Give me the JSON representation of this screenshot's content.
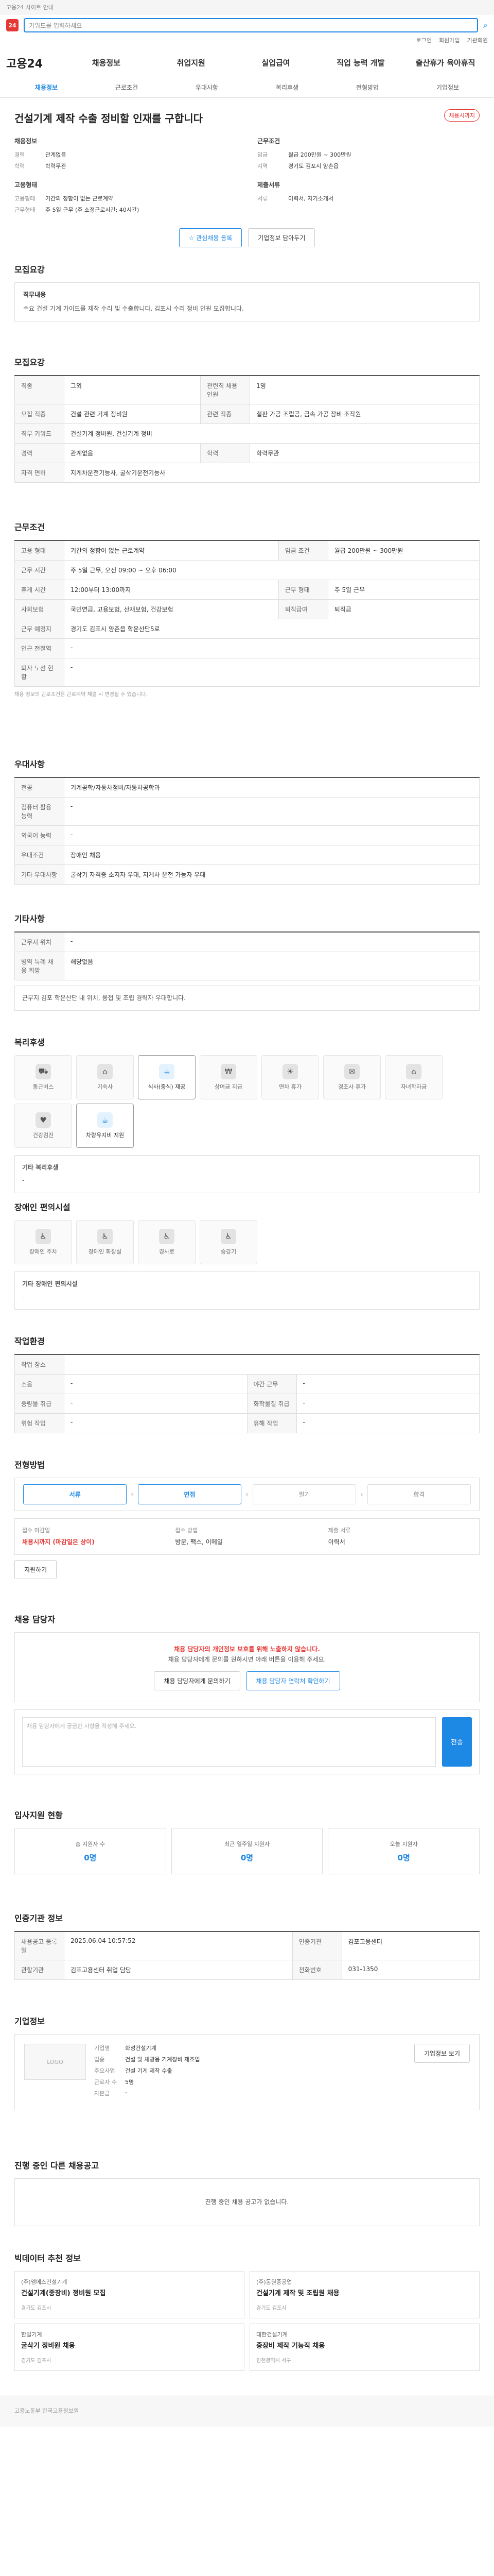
{
  "notice": "고용24 사이트 안내",
  "search": {
    "placeholder": "키워드를 입력하세요"
  },
  "util": [
    "로그인",
    "회원가입",
    "기관회원"
  ],
  "gnb": {
    "brand": "고용24",
    "items": [
      "채용정보",
      "취업지원",
      "실업급여",
      "직업 능력 개발",
      "출산휴가 육아휴직"
    ]
  },
  "lnb": [
    {
      "label": "채용정보",
      "on": true
    },
    {
      "label": "근로조건",
      "on": false
    },
    {
      "label": "우대사항",
      "on": false
    },
    {
      "label": "복리후생",
      "on": false
    },
    {
      "label": "전형방법",
      "on": false
    },
    {
      "label": "기업정보",
      "on": false
    }
  ],
  "summary": {
    "badge": "채용시까지",
    "title": "건설기계 제작 수출 정비할 인재를 구합니다",
    "left": {
      "heading": "채용정보",
      "rows": [
        {
          "k": "경력",
          "v": "관계없음"
        },
        {
          "k": "학력",
          "v": "학력무관"
        }
      ]
    },
    "left2": {
      "heading": "고용형태",
      "rows": [
        {
          "k": "고용형태",
          "v": "기간의 정함이 없는 근로계약"
        },
        {
          "k": "근무형태",
          "v": "주 5일 근무 (주 소정근로시간: 40시간)"
        }
      ]
    },
    "right": {
      "heading": "근무조건",
      "rows": [
        {
          "k": "임금",
          "v": "월급 200만원 ~ 300만원"
        },
        {
          "k": "지역",
          "v": "경기도 김포시 양촌읍"
        }
      ]
    },
    "right2": {
      "heading": "제출서류",
      "rows": [
        {
          "k": "서류",
          "v": "이력서, 자기소개서"
        }
      ]
    },
    "btn_apply": "관심채용 등록",
    "btn_share": "기업정보 담아두기"
  },
  "intro": {
    "title": "모집요강",
    "heading": "직무내용",
    "text": "수요 건설 기계 가이드를 제작 수리 및 수출합니다. 김포시 수리 정비 인원 모집합니다."
  },
  "req": {
    "title": "모집요강",
    "rows": [
      {
        "k": "직종",
        "v": "그외",
        "k2": "관련직 채용 인원",
        "v2": "1명"
      },
      {
        "k": "모집 직종",
        "v": "건설 관련 기계 정비원",
        "k2": "관련 직종",
        "v2": "철판 가공 조립공, 금속 가공 장비 조작원"
      },
      {
        "k": "직무 키워드",
        "v": "건설기계 정비원, 건설기계 정비",
        "k2": "",
        "v2": ""
      },
      {
        "k": "경력",
        "v": "관계없음",
        "k2": "학력",
        "v2": "학력무관"
      },
      {
        "k": "자격 면허",
        "v": "지게차운전기능사, 굴삭기운전기능사",
        "k2": "",
        "v2": ""
      }
    ]
  },
  "cond": {
    "title": "근무조건",
    "rows": [
      {
        "k": "고용 형태",
        "v": "기간의 정함이 없는 근로계약",
        "k2": "임금 조건",
        "v2": "월급 200만원 ~ 300만원"
      },
      {
        "k": "근무 시간",
        "v": "주 5일 근무, 오전 09:00 ~ 오후 06:00",
        "k2": "",
        "v2": ""
      },
      {
        "k": "휴게 시간",
        "v": "12:00부터 13:00까지",
        "k2": "근무 형태",
        "v2": "주 5일 근무"
      },
      {
        "k": "사회보험",
        "v": "국민연금, 고용보험, 산재보험, 건강보험",
        "k2": "퇴직급여",
        "v2": "퇴직금"
      },
      {
        "k": "근무 예정지",
        "v": "경기도 김포시 양촌읍 학운산단5로",
        "k2": "",
        "v2": ""
      },
      {
        "k": "인근 전철역",
        "v": "-",
        "k2": "",
        "v2": ""
      },
      {
        "k": "퇴사 노선 현황",
        "v": "-",
        "k2": "",
        "v2": ""
      }
    ],
    "note": "채용 정보의 근로조건은 근로계약 체결 시 변경될 수 있습니다."
  },
  "pref": {
    "title": "우대사항",
    "rows": [
      {
        "k": "전공",
        "v": "기계공학/자동차정비/자동차공학과"
      },
      {
        "k": "컴퓨터 활용 능력",
        "v": "-"
      },
      {
        "k": "외국어 능력",
        "v": "-"
      },
      {
        "k": "우대조건",
        "v": "장애인 채용"
      },
      {
        "k": "기타 우대사항",
        "v": "굴삭기 자격증 소지자 우대, 지게차 운전 가능자 우대"
      }
    ]
  },
  "etc": {
    "title": "기타사항",
    "rows": [
      {
        "k": "근무지 위치",
        "v": "-"
      },
      {
        "k": "병역 특례 채용 희망",
        "v": "해당없음"
      }
    ],
    "detail": "근무지 김포 학운산단 내 위치, 용접 및 조립 경력자 우대합니다."
  },
  "welfare": {
    "title": "복리후생",
    "items": [
      {
        "icon": "bus-icon",
        "glyph": "⛟",
        "label": "통근버스",
        "on": false
      },
      {
        "icon": "dormitory-icon",
        "glyph": "⌂",
        "label": "기숙사",
        "on": false
      },
      {
        "icon": "meal-icon",
        "glyph": "☕",
        "label": "식사(중식) 제공",
        "on": true
      },
      {
        "icon": "bonus-icon",
        "glyph": "₩",
        "label": "상여금 지급",
        "on": false
      },
      {
        "icon": "holiday-icon",
        "glyph": "☀",
        "label": "연차 휴가",
        "on": false
      },
      {
        "icon": "gift-icon",
        "glyph": "✉",
        "label": "경조사 휴가",
        "on": false
      },
      {
        "icon": "house-icon",
        "glyph": "⌂",
        "label": "자녀학자금",
        "on": false
      },
      {
        "icon": "heart-icon",
        "glyph": "♥",
        "label": "건강검진",
        "on": false
      },
      {
        "icon": "coffee-icon",
        "glyph": "☕",
        "label": "차량유지비 지원",
        "on": true
      }
    ],
    "etc_label": "기타 복리후생",
    "etc_val": "-"
  },
  "disab": {
    "title": "장애인 편의시설",
    "items": [
      "장애인 주차",
      "장애인 화장실",
      "경사로",
      "승강기"
    ],
    "etc_label": "기타 장애인 편의시설",
    "etc_val": "-"
  },
  "worksite": {
    "title": "작업환경",
    "rows": [
      {
        "k": "작업 장소",
        "v": "-",
        "k2": "",
        "v2": ""
      },
      {
        "k": "소음",
        "v": "-",
        "k2": "야간 근무",
        "v2": "-"
      },
      {
        "k": "중량물 취급",
        "v": "-",
        "k2": "화학물질 취급",
        "v2": "-"
      },
      {
        "k": "위험 작업",
        "v": "-",
        "k2": "유해 작업",
        "v2": "-"
      }
    ]
  },
  "recruit": {
    "title": "전형방법",
    "steps": [
      "서류",
      "면접",
      "필기",
      "합격"
    ],
    "apply": [
      {
        "label": "접수 마감일",
        "value": "채용시까지 (마감일은 상이)",
        "red": true
      },
      {
        "label": "접수 방법",
        "value": "방문, 팩스, 이메일",
        "red": false
      },
      {
        "label": "제출 서류",
        "value": "이력서",
        "red": false
      }
    ],
    "btn": "지원하기"
  },
  "manager": {
    "title": "채용 담당자",
    "note": "채용 담당자의 개인정보 보호를 위해 노출하지 않습니다.",
    "note2": "채용 담당자에게 문의를 원하시면 아래 버튼을 이용해 주세요.",
    "btn1": "채용 담당자에게 문의하기",
    "btn2": "채용 담당자 연락처 확인하기",
    "q_placeholder": "채용 담당자에게 궁금한 사항을 작성해 주세요.",
    "q_btn": "전송"
  },
  "applicants": {
    "title": "입사지원 현황",
    "items": [
      {
        "label": "총 지원자 수",
        "value": "0명"
      },
      {
        "label": "최근 일주일 지원자",
        "value": "0명"
      },
      {
        "label": "오늘 지원자",
        "value": "0명"
      }
    ]
  },
  "agency": {
    "title": "인증기관 정보",
    "rows": [
      {
        "k": "채용공고 등록일",
        "v": "2025.06.04 10:57:52",
        "k2": "인증기관",
        "v2": "김포고용센터"
      },
      {
        "k": "관할기관",
        "v": "김포고용센터 취업 담당",
        "k2": "전화번호",
        "v2": "031-1350"
      }
    ]
  },
  "corp": {
    "title": "기업정보",
    "logo": "LOGO",
    "rows": [
      {
        "k": "기업명",
        "v": "화성건설기계"
      },
      {
        "k": "업종",
        "v": "건설 및 채광용 기계장비 제조업"
      },
      {
        "k": "주요사업",
        "v": "건설 기계 제작 수출"
      },
      {
        "k": "근로자 수",
        "v": "5명"
      },
      {
        "k": "자본금",
        "v": "-"
      }
    ],
    "btn": "기업정보 보기"
  },
  "similar": {
    "title": "진행 중인 다른 채용공고",
    "empty": "진행 중인 채용 공고가 없습니다."
  },
  "recs": {
    "title": "빅데이터 추천 정보",
    "items": [
      {
        "co": "(주)엠에스건설기계",
        "t": "건설기계(중장비) 정비원 모집",
        "m": "경기도 김포시"
      },
      {
        "co": "(주)동원중공업",
        "t": "건설기계 제작 및 조립원 채용",
        "m": "경기도 김포시"
      },
      {
        "co": "한일기계",
        "t": "굴삭기 정비원 채용",
        "m": "경기도 김포시"
      },
      {
        "co": "대한건설기계",
        "t": "중장비 제작 기능직 채용",
        "m": "인천광역시 서구"
      }
    ]
  },
  "footer": "고용노동부 한국고용정보원"
}
